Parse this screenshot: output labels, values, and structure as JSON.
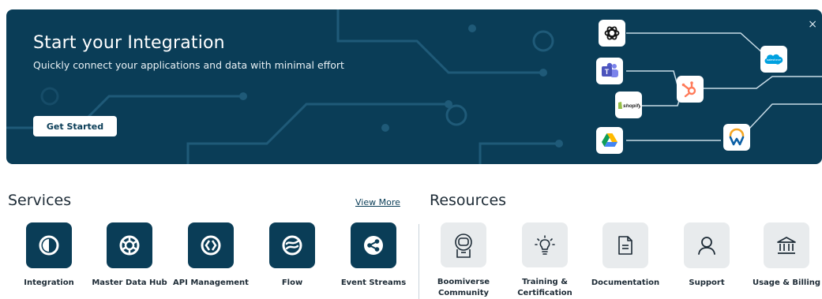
{
  "banner": {
    "title": "Start your Integration",
    "subtitle": "Quickly connect your applications and data with minimal effort",
    "cta_label": "Get Started",
    "close_glyph": "×",
    "logos": [
      {
        "name": "openai-logo",
        "text": ""
      },
      {
        "name": "microsoft-teams-logo",
        "text": ""
      },
      {
        "name": "shopify-logo",
        "text": "shopify"
      },
      {
        "name": "google-drive-logo",
        "text": ""
      },
      {
        "name": "hubspot-logo",
        "text": ""
      },
      {
        "name": "salesforce-logo",
        "text": "salesforce"
      },
      {
        "name": "workday-logo",
        "text": ""
      }
    ],
    "colors": {
      "background": "#0a3d57",
      "circuit_line": "#1f5a78"
    }
  },
  "services": {
    "title": "Services",
    "view_more": "View More",
    "items": [
      {
        "label": "Integration",
        "icon": "integration-icon"
      },
      {
        "label": "Master Data Hub",
        "icon": "master-data-hub-icon"
      },
      {
        "label": "API Management",
        "icon": "api-management-icon"
      },
      {
        "label": "Flow",
        "icon": "flow-icon"
      },
      {
        "label": "Event Streams",
        "icon": "event-streams-icon"
      }
    ]
  },
  "resources": {
    "title": "Resources",
    "items": [
      {
        "label_line1": "Boomiverse",
        "label_line2": "Community",
        "icon": "astronaut-icon"
      },
      {
        "label_line1": "Training &",
        "label_line2": "Certification",
        "icon": "lightbulb-icon"
      },
      {
        "label_line1": "Documentation",
        "label_line2": "",
        "icon": "document-icon"
      },
      {
        "label_line1": "Support",
        "label_line2": "",
        "icon": "person-icon"
      },
      {
        "label_line1": "Usage & Billing",
        "label_line2": "",
        "icon": "bank-icon"
      }
    ]
  },
  "colors": {
    "accent": "#0a3d57",
    "tile_light": "#e8ebed",
    "text": "#1d2b36"
  }
}
